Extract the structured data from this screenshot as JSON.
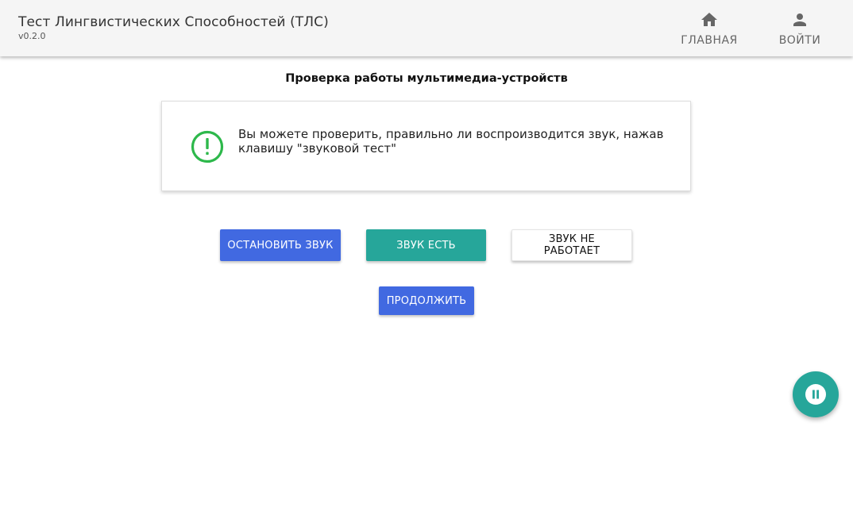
{
  "header": {
    "title": "Тест Лингвистических Способностей (ТЛС)",
    "version": "v0.2.0",
    "nav": [
      {
        "label": "ГЛАВНАЯ",
        "icon": "home-icon"
      },
      {
        "label": "ВОЙТИ",
        "icon": "person-icon"
      }
    ]
  },
  "main": {
    "title": "Проверка работы мультимедиа-устройств",
    "info": {
      "icon": "alert-circle-icon",
      "text": "Вы можете проверить, правильно ли воспроизводится звук, нажав клавишу \"звуковой тест\""
    },
    "buttons": {
      "stop_sound": "ОСТАНОВИТЬ ЗВУК",
      "sound_ok": "ЗВУК ЕСТЬ",
      "sound_not_working": "ЗВУК НЕ РАБОТАЕТ",
      "continue": "ПРОДОЛЖИТЬ"
    }
  },
  "fab": {
    "icon": "pause-icon"
  },
  "colors": {
    "primary": "#4169e1",
    "teal": "#26a69a",
    "success": "#2db84b",
    "header_bg": "#f5f5f5"
  }
}
